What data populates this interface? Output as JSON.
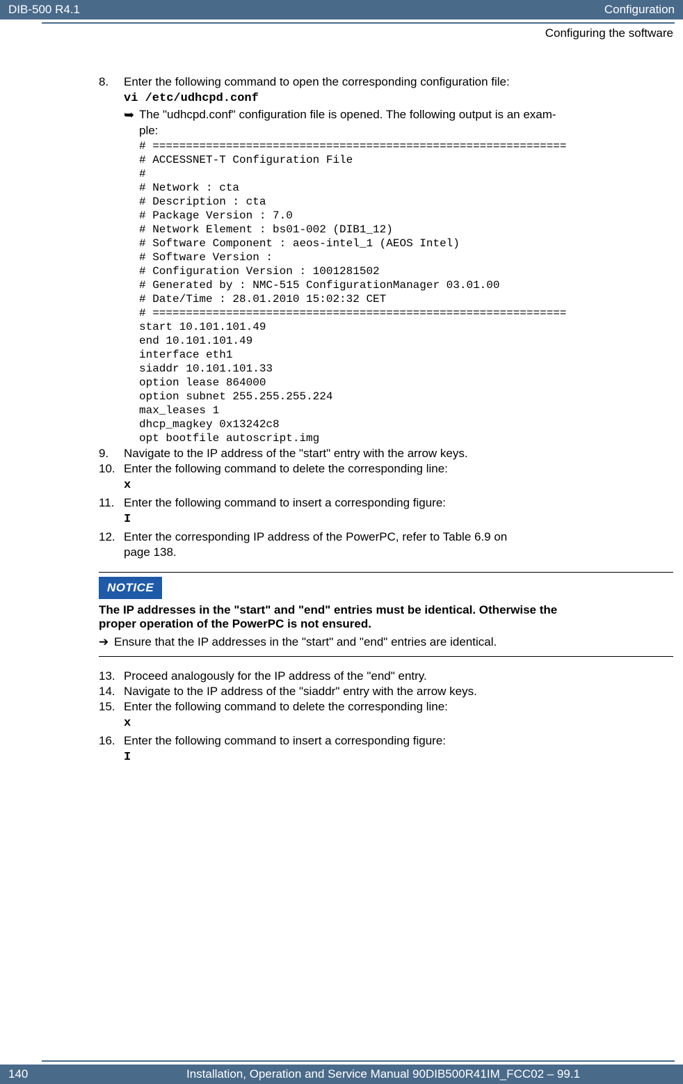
{
  "header": {
    "left": "DIB-500 R4.1",
    "right": "Configuration",
    "sub": "Configuring the software"
  },
  "steps": {
    "s8_num": "8.",
    "s8_text": "Enter the following command to open the corresponding configuration file:",
    "s8_cmd": "vi /etc/udhcpd.conf",
    "s8_arrow_text": "The \"udhcpd.conf\" configuration file is opened. The following output is an exam-",
    "s8_arrow_text2": "ple:",
    "s8_code": "# ==============================================================\n# ACCESSNET-T Configuration File\n#\n# Network : cta\n# Description : cta\n# Package Version : 7.0\n# Network Element : bs01-002 (DIB1_12)\n# Software Component : aeos-intel_1 (AEOS Intel)\n# Software Version :\n# Configuration Version : 1001281502\n# Generated by : NMC-515 ConfigurationManager 03.01.00\n# Date/Time : 28.01.2010 15:02:32 CET\n# ==============================================================\nstart 10.101.101.49\nend 10.101.101.49\ninterface eth1\nsiaddr 10.101.101.33\noption lease 864000\noption subnet 255.255.255.224\nmax_leases 1\ndhcp_magkey 0x13242c8\nopt bootfile autoscript.img",
    "s9_num": "9.",
    "s9_text": "Navigate to the IP address of the \"start\" entry with the arrow keys.",
    "s10_num": "10.",
    "s10_text": "Enter the following command to delete the corresponding line:",
    "s10_cmd": "x",
    "s11_num": "11.",
    "s11_text": "Enter the following command to insert a corresponding figure:",
    "s11_cmd": "I",
    "s12_num": "12.",
    "s12_text": "Enter the corresponding IP address of the PowerPC, refer to Table 6.9 on",
    "s12_text2": "page 138.",
    "s13_num": "13.",
    "s13_text": "Proceed analogously for the IP address of the \"end\" entry.",
    "s14_num": "14.",
    "s14_text": "Navigate to the IP address of the \"siaddr\" entry with the arrow keys.",
    "s15_num": "15.",
    "s15_text": "Enter the following command to delete the corresponding line:",
    "s15_cmd": "x",
    "s16_num": "16.",
    "s16_text": "Enter the following command to insert a corresponding figure:",
    "s16_cmd": "I"
  },
  "notice": {
    "label": "NOTICE",
    "bold1": "The IP addresses in the \"start\" and \"end\" entries must be identical. Otherwise the",
    "bold2": "proper operation of the PowerPC is not ensured.",
    "action": "Ensure that the IP addresses in the \"start\" and \"end\" entries are identical."
  },
  "footer": {
    "page": "140",
    "text": "Installation, Operation and Service Manual 90DIB500R41IM_FCC02  –  99.1"
  }
}
